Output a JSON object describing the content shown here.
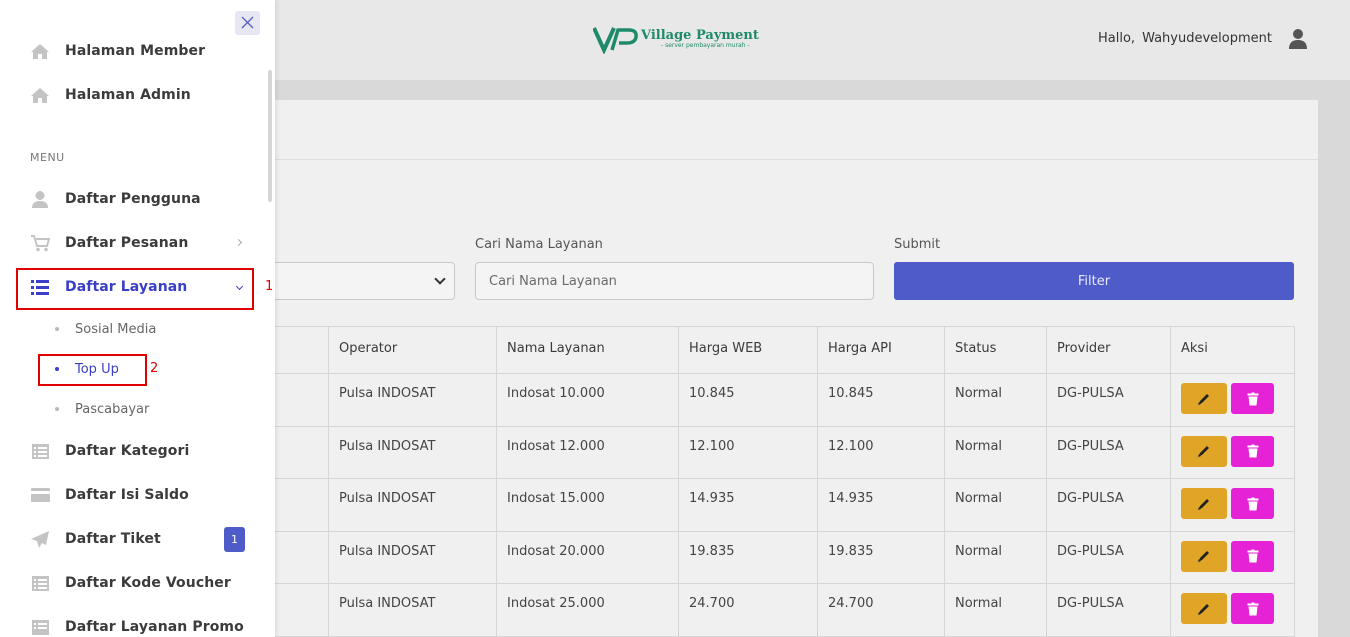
{
  "header": {
    "logo_title": "Village Payment",
    "logo_subtitle": "- server pembayaran murah -",
    "greeting_prefix": "Hallo,",
    "username": "Wahyudevelopment"
  },
  "filters": {
    "search_label": "Cari Nama Layanan",
    "search_placeholder": "Cari Nama Layanan",
    "submit_label": "Submit",
    "filter_button": "Filter"
  },
  "table": {
    "headers": [
      "Operator",
      "Nama Layanan",
      "Harga WEB",
      "Harga API",
      "Status",
      "Provider",
      "Aksi"
    ],
    "rows": [
      [
        "Pulsa INDOSAT",
        "Indosat 10.000",
        "10.845",
        "10.845",
        "Normal",
        "DG-PULSA"
      ],
      [
        "Pulsa INDOSAT",
        "Indosat 12.000",
        "12.100",
        "12.100",
        "Normal",
        "DG-PULSA"
      ],
      [
        "Pulsa INDOSAT",
        "Indosat 15.000",
        "14.935",
        "14.935",
        "Normal",
        "DG-PULSA"
      ],
      [
        "Pulsa INDOSAT",
        "Indosat 20.000",
        "19.835",
        "19.835",
        "Normal",
        "DG-PULSA"
      ],
      [
        "Pulsa INDOSAT",
        "Indosat 25.000",
        "24.700",
        "24.700",
        "Normal",
        "DG-PULSA"
      ]
    ]
  },
  "sidebar": {
    "top_items": [
      {
        "label": "Halaman Member",
        "icon": "home-icon"
      },
      {
        "label": "Halaman Admin",
        "icon": "home-icon"
      }
    ],
    "menu_heading": "MENU",
    "items": [
      {
        "label": "Daftar Pengguna",
        "icon": "user-icon"
      },
      {
        "label": "Daftar Pesanan",
        "icon": "cart-icon"
      },
      {
        "label": "Daftar Layanan",
        "icon": "list-icon"
      },
      {
        "label": "Daftar Kategori",
        "icon": "list-alt-icon"
      },
      {
        "label": "Daftar Isi Saldo",
        "icon": "credit-card-icon"
      },
      {
        "label": "Daftar Tiket",
        "icon": "paper-plane-icon"
      },
      {
        "label": "Daftar Kode Voucher",
        "icon": "list-alt-icon"
      },
      {
        "label": "Daftar Layanan Promo",
        "icon": "list-alt-icon"
      }
    ],
    "sub_items": [
      "Sosial Media",
      "Top Up",
      "Pascabayar"
    ],
    "ticket_badge": "1"
  },
  "annotations": {
    "step1": "1",
    "step2": "2"
  },
  "colors": {
    "accent": "#4e5bc9",
    "edit_button": "#e0a526",
    "delete_button": "#e622d6",
    "annotation": "#e00000"
  }
}
